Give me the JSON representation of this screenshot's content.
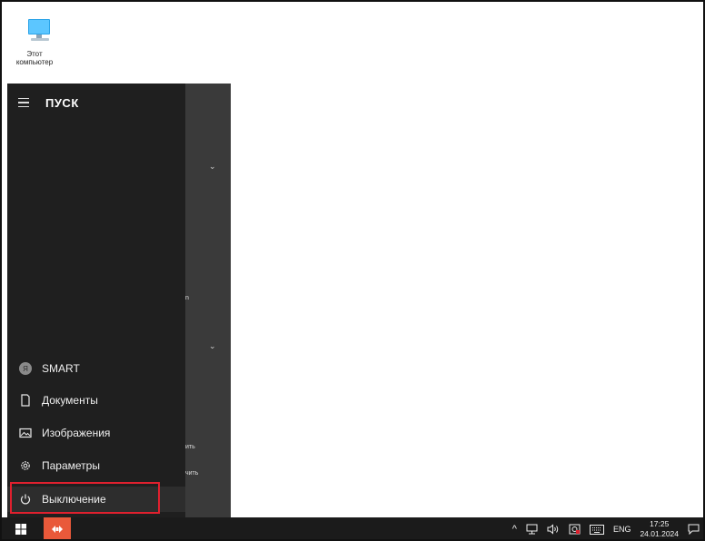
{
  "desktop": {
    "icon_label": "Этот компьютер"
  },
  "start_menu": {
    "title": "ПУСК",
    "items": [
      {
        "label": "SMART",
        "icon": "user-avatar-icon",
        "badge": "Я"
      },
      {
        "label": "Документы",
        "icon": "document-icon"
      },
      {
        "label": "Изображения",
        "icon": "pictures-icon"
      },
      {
        "label": "Параметры",
        "icon": "gear-icon"
      },
      {
        "label": "Выключение",
        "icon": "power-icon"
      }
    ],
    "right_fragments": [
      "n",
      "ить",
      "чить"
    ],
    "highlight_color": "#e0202e"
  },
  "taskbar": {
    "language": "ENG",
    "time": "17:25",
    "date": "24.01.2024",
    "app_color": "#e9593a"
  }
}
